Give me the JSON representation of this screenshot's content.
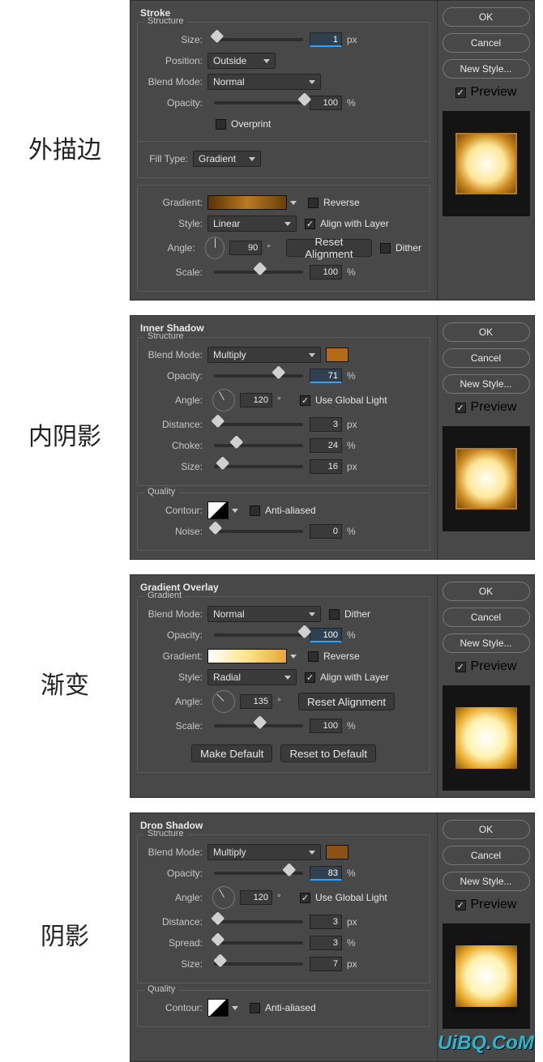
{
  "labels": {
    "stroke_cn": "外描边",
    "inner_cn": "内阴影",
    "grad_cn": "渐变",
    "drop_cn": "阴影"
  },
  "sidebar": {
    "ok": "OK",
    "cancel": "Cancel",
    "new_style": "New Style...",
    "preview": "Preview"
  },
  "common": {
    "blend_mode": "Blend Mode:",
    "opacity": "Opacity:",
    "angle": "Angle:",
    "size": "Size:",
    "distance": "Distance:",
    "choke": "Choke:",
    "spread": "Spread:",
    "noise": "Noise:",
    "scale": "Scale:",
    "gradient": "Gradient:",
    "style": "Style:",
    "contour": "Contour:",
    "px": "px",
    "pct": "%",
    "deg": "°",
    "reverse": "Reverse",
    "align_layer": "Align with Layer",
    "dither": "Dither",
    "anti": "Anti-aliased",
    "global_light": "Use Global Light",
    "reset_align": "Reset Alignment",
    "make_default": "Make Default",
    "reset_default": "Reset to Default"
  },
  "stroke": {
    "title": "Stroke",
    "legend": "Structure",
    "size": "1",
    "position_label": "Position:",
    "position": "Outside",
    "blend": "Normal",
    "opacity": "100",
    "overprint": "Overprint",
    "fill_type_label": "Fill Type:",
    "fill_type": "Gradient",
    "style": "Linear",
    "angle": "90",
    "scale": "100",
    "reverse": false,
    "align": true,
    "dither": false
  },
  "inner": {
    "title": "Inner Shadow",
    "legend_top": "Structure",
    "legend_q": "Quality",
    "blend": "Multiply",
    "swatch": "#b56a16",
    "opacity": "71",
    "angle": "120",
    "global_light": true,
    "distance": "3",
    "choke": "24",
    "size": "16",
    "anti": false,
    "noise": "0"
  },
  "grad": {
    "title": "Gradient Overlay",
    "legend": "Gradient",
    "blend": "Normal",
    "dither": false,
    "opacity": "100",
    "reverse": false,
    "style": "Radial",
    "align": true,
    "angle": "135",
    "scale": "100"
  },
  "drop": {
    "title": "Drop Shadow",
    "legend_top": "Structure",
    "legend_q": "Quality",
    "blend": "Multiply",
    "swatch": "#8a5216",
    "opacity": "83",
    "angle": "120",
    "global_light": true,
    "distance": "3",
    "spread": "3",
    "size": "7",
    "anti": false
  },
  "watermark": "UiBQ.CoM"
}
